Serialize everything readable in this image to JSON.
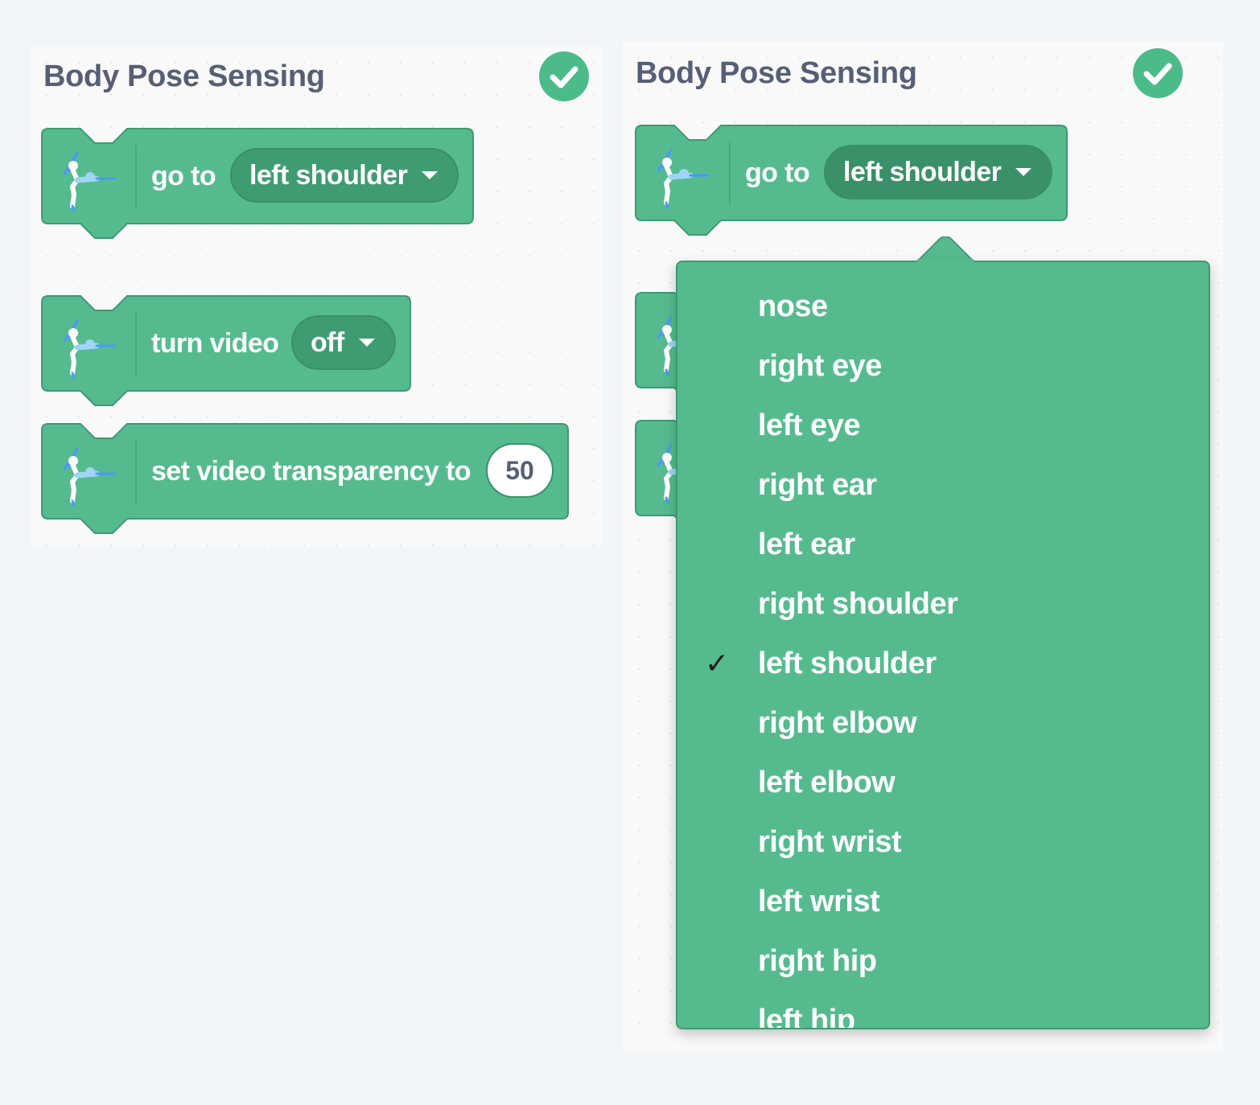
{
  "colors": {
    "block_fill": "#55bb8f",
    "block_edge": "#3e9a71",
    "pill_fill": "#3f9c72",
    "title_text": "#575e75",
    "check_fill": "#4cbb8a"
  },
  "left_panel": {
    "title": "Body Pose Sensing",
    "status_icon": "check-circle-icon",
    "blocks": {
      "go_to": {
        "label": "go to",
        "menu_value": "left shoulder"
      },
      "turn_video": {
        "label": "turn video",
        "menu_value": "off"
      },
      "set_transparency": {
        "label": "set video transparency to",
        "value": "50"
      }
    }
  },
  "right_panel": {
    "title": "Body Pose Sensing",
    "status_icon": "check-circle-icon",
    "blocks": {
      "go_to": {
        "label": "go to",
        "menu_value": "left shoulder"
      }
    }
  },
  "dropdown": {
    "selected_mark": "✓",
    "items": [
      {
        "label": "nose"
      },
      {
        "label": "right eye"
      },
      {
        "label": "left eye"
      },
      {
        "label": "right ear"
      },
      {
        "label": "left ear"
      },
      {
        "label": "right shoulder"
      },
      {
        "label": "left shoulder",
        "selected": true
      },
      {
        "label": "right elbow"
      },
      {
        "label": "left elbow"
      },
      {
        "label": "right wrist"
      },
      {
        "label": "left wrist"
      },
      {
        "label": "right hip"
      },
      {
        "label": "left hip"
      }
    ]
  }
}
